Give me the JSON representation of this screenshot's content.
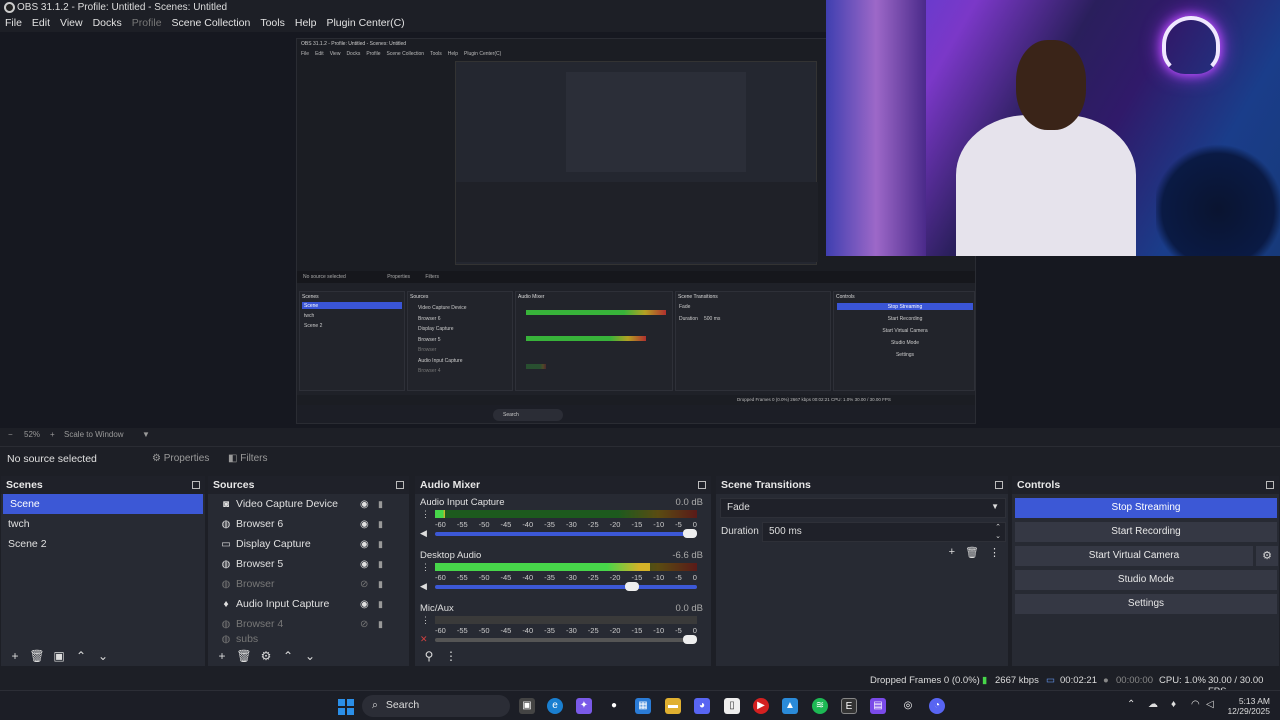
{
  "window": {
    "title": "OBS 31.1.2 - Profile: Untitled - Scenes: Untitled"
  },
  "menu": [
    "File",
    "Edit",
    "View",
    "Docks",
    "Profile",
    "Scene Collection",
    "Tools",
    "Help",
    "Plugin Center(C)"
  ],
  "nested": {
    "title": "OBS 31.1.2 - Profile: Untitled - Scenes: Untitled",
    "menu": [
      "File",
      "Edit",
      "View",
      "Docks",
      "Profile",
      "Scene Collection",
      "Tools",
      "Help",
      "Plugin Center(C)"
    ],
    "no_source": "No source selected",
    "properties": "Properties",
    "filters": "Filters",
    "docks": {
      "scenes": "Scenes",
      "sources": "Sources",
      "mixer": "Audio Mixer",
      "transitions": "Scene Transitions",
      "controls": "Controls"
    },
    "scenes": [
      "Scene",
      "twch",
      "Scene 2"
    ],
    "sources": [
      "Video Capture Device",
      "Browser 6",
      "Display Capture",
      "Browser 5",
      "Browser",
      "Audio Input Capture",
      "Browser 4"
    ],
    "controls": [
      "Stop Streaming",
      "Start Recording",
      "Start Virtual Camera",
      "Studio Mode",
      "Settings"
    ],
    "fade": "Fade",
    "duration": "Duration",
    "duration_value": "500 ms",
    "status": "Dropped Frames 0 (0.0%)   2667 kbps   00:02:21   CPU: 1.0%   30.00 / 30.00 FPS",
    "search": "Search"
  },
  "zoom": {
    "percent": "52%",
    "mode": "Scale to Window"
  },
  "source_bar": {
    "label": "No source selected",
    "properties": "Properties",
    "filters": "Filters"
  },
  "scenes": {
    "title": "Scenes",
    "items": [
      "Scene",
      "twch",
      "Scene 2"
    ]
  },
  "sources": {
    "title": "Sources",
    "items": [
      {
        "name": "Video Capture Device",
        "icon": "camera-icon",
        "visible": true
      },
      {
        "name": "Browser 6",
        "icon": "globe-icon",
        "visible": true
      },
      {
        "name": "Display Capture",
        "icon": "monitor-icon",
        "visible": true
      },
      {
        "name": "Browser 5",
        "icon": "globe-icon",
        "visible": true
      },
      {
        "name": "Browser",
        "icon": "globe-icon",
        "visible": false
      },
      {
        "name": "Audio Input Capture",
        "icon": "mic-icon",
        "visible": true
      },
      {
        "name": "Browser 4",
        "icon": "globe-icon",
        "visible": false
      },
      {
        "name": "subs",
        "icon": "globe-icon",
        "visible": false
      }
    ]
  },
  "mixer": {
    "title": "Audio Mixer",
    "scale": [
      "-60",
      "-55",
      "-50",
      "-45",
      "-40",
      "-35",
      "-30",
      "-25",
      "-20",
      "-15",
      "-10",
      "-5",
      "0"
    ],
    "channels": [
      {
        "name": "Audio Input Capture",
        "db": "0.0 dB",
        "level": 0.04,
        "fader": 1.0,
        "muted": false
      },
      {
        "name": "Desktop Audio",
        "db": "-6.6 dB",
        "level": 0.82,
        "fader": 0.78,
        "muted": false
      },
      {
        "name": "Mic/Aux",
        "db": "0.0 dB",
        "level": 0,
        "fader": 1.0,
        "muted": true
      }
    ]
  },
  "transitions": {
    "title": "Scene Transitions",
    "type": "Fade",
    "duration_label": "Duration",
    "duration": "500 ms"
  },
  "controls": {
    "title": "Controls",
    "stop_streaming": "Stop Streaming",
    "start_recording": "Start Recording",
    "start_virtual_camera": "Start Virtual Camera",
    "studio_mode": "Studio Mode",
    "settings": "Settings"
  },
  "status": {
    "dropped": "Dropped Frames 0 (0.0%)",
    "bitrate": "2667 kbps",
    "stream_time": "00:02:21",
    "rec_time": "00:00:00",
    "cpu": "CPU: 1.0%",
    "fps": "30.00 / 30.00 FPS"
  },
  "taskbar": {
    "search": "Search",
    "time": "5:13 AM",
    "date": "12/29/2025"
  },
  "colors": {
    "accent": "#3c58d6",
    "panel": "#272a33",
    "bg": "#1d1f26"
  }
}
